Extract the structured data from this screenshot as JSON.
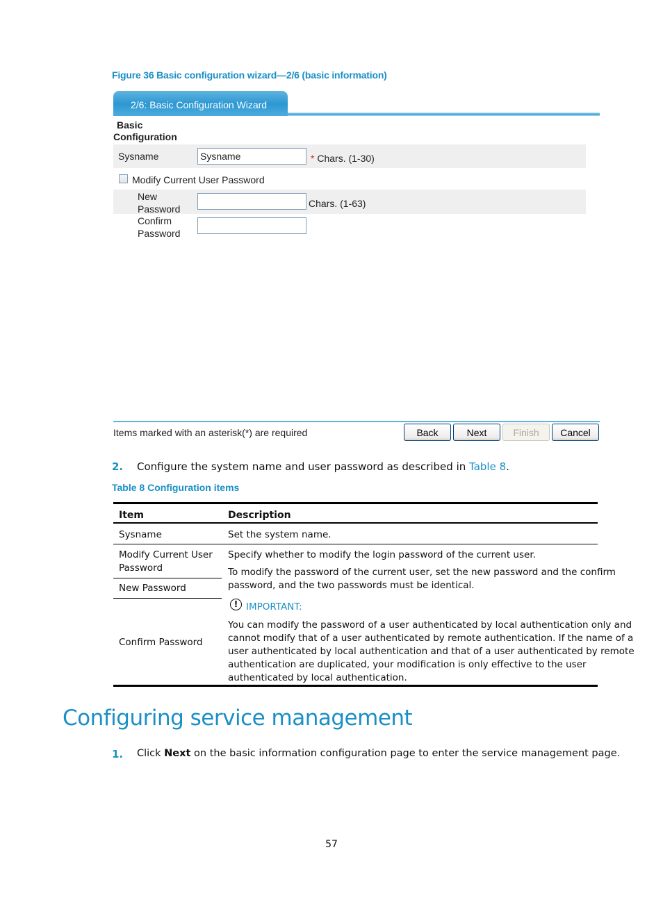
{
  "figure_caption": "Figure 36 Basic configuration wizard—2/6 (basic information)",
  "wizard": {
    "tab_label": "2/6: Basic Configuration Wizard",
    "section_title_line1": "Basic",
    "section_title_line2": "Configuration",
    "sysname": {
      "label": "Sysname",
      "value": "Sysname",
      "required_mark": "*",
      "hint": "Chars. (1-30)"
    },
    "modify_password": {
      "label": "Modify Current User Password",
      "checked": false
    },
    "new_password": {
      "label_line1": "New",
      "label_line2": "Password",
      "value": "",
      "hint": "Chars. (1-63)"
    },
    "confirm_password": {
      "label_line1": "Confirm",
      "label_line2": "Password",
      "value": ""
    },
    "footer_note": "Items marked with an asterisk(*) are required",
    "buttons": {
      "back": "Back",
      "next": "Next",
      "finish": "Finish",
      "cancel": "Cancel"
    }
  },
  "step2": {
    "number": "2.",
    "text_before": "Configure the system name and user password as described in ",
    "link": "Table 8",
    "text_after": "."
  },
  "table": {
    "caption": "Table 8 Configuration items",
    "headers": [
      "Item",
      "Description"
    ],
    "items": [
      "Sysname",
      "Modify Current User Password",
      "New Password",
      "Confirm Password"
    ],
    "descriptions": {
      "sysname": "Set the system name.",
      "modify_line": "Specify whether to modify the login password of the current user.",
      "passwords_line1": "To modify the password of the current user, set the new password and the confirm",
      "passwords_line2": "password, and the two passwords must be identical.",
      "important_label": "IMPORTANT:",
      "important_lines": [
        "You can modify the password of a user authenticated by local authentication only and",
        "cannot modify that of a user authenticated by remote authentication. If the name of a",
        "user authenticated by local authentication and that of a user authenticated by remote",
        "authentication are duplicated, your modification is only effective to the user",
        "authenticated by local authentication."
      ]
    }
  },
  "section_heading": "Configuring service management",
  "step1": {
    "number": "1.",
    "text_before": "Click ",
    "bold": "Next",
    "text_after": " on the basic information configuration page to enter the service management page."
  },
  "page_number": "57"
}
